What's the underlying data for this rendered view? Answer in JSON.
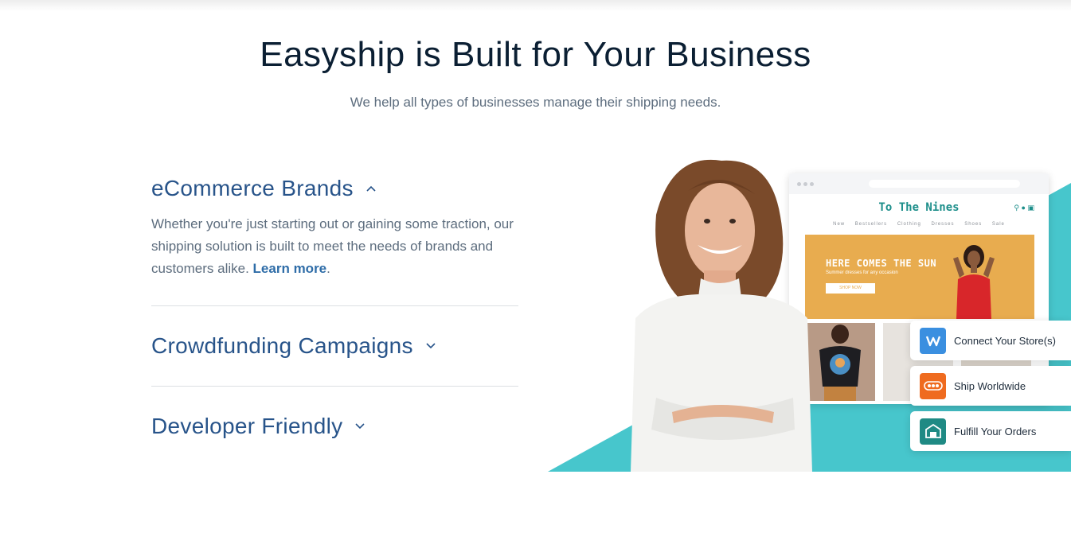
{
  "header": {
    "title": "Easyship is Built for Your Business",
    "subtitle": "We help all types of businesses manage their shipping needs."
  },
  "accordion": {
    "items": [
      {
        "title": "eCommerce Brands",
        "expanded": true,
        "body": "Whether you're just starting out or gaining some traction, our shipping solution is built to meet the needs of brands and customers alike. ",
        "link_text": "Learn more",
        "trailing": "."
      },
      {
        "title": "Crowdfunding Campaigns",
        "expanded": false
      },
      {
        "title": "Developer Friendly",
        "expanded": false
      }
    ]
  },
  "store_mockup": {
    "store_name": "To The Nines",
    "nav": [
      "New",
      "Bestsellers",
      "Clothing",
      "Dresses",
      "Shoes",
      "Sale"
    ],
    "banner_title": "HERE COMES THE SUN",
    "banner_subtitle": "Summer dresses for any occasion",
    "banner_button": "SHOP NOW"
  },
  "features": [
    {
      "label": "Connect Your Store(s)",
      "icon": "weebly-icon",
      "color": "#3a8fe0"
    },
    {
      "label": "Ship Worldwide",
      "icon": "courier-icon",
      "color": "#ef6b1f"
    },
    {
      "label": "Fulfill Your Orders",
      "icon": "warehouse-icon",
      "color": "#1f8a84"
    }
  ],
  "colors": {
    "teal_accent": "#47c6cc",
    "heading": "#0b1f33",
    "accordion_title": "#28548a",
    "link": "#2f6da8",
    "banner": "#e8ac4f"
  }
}
